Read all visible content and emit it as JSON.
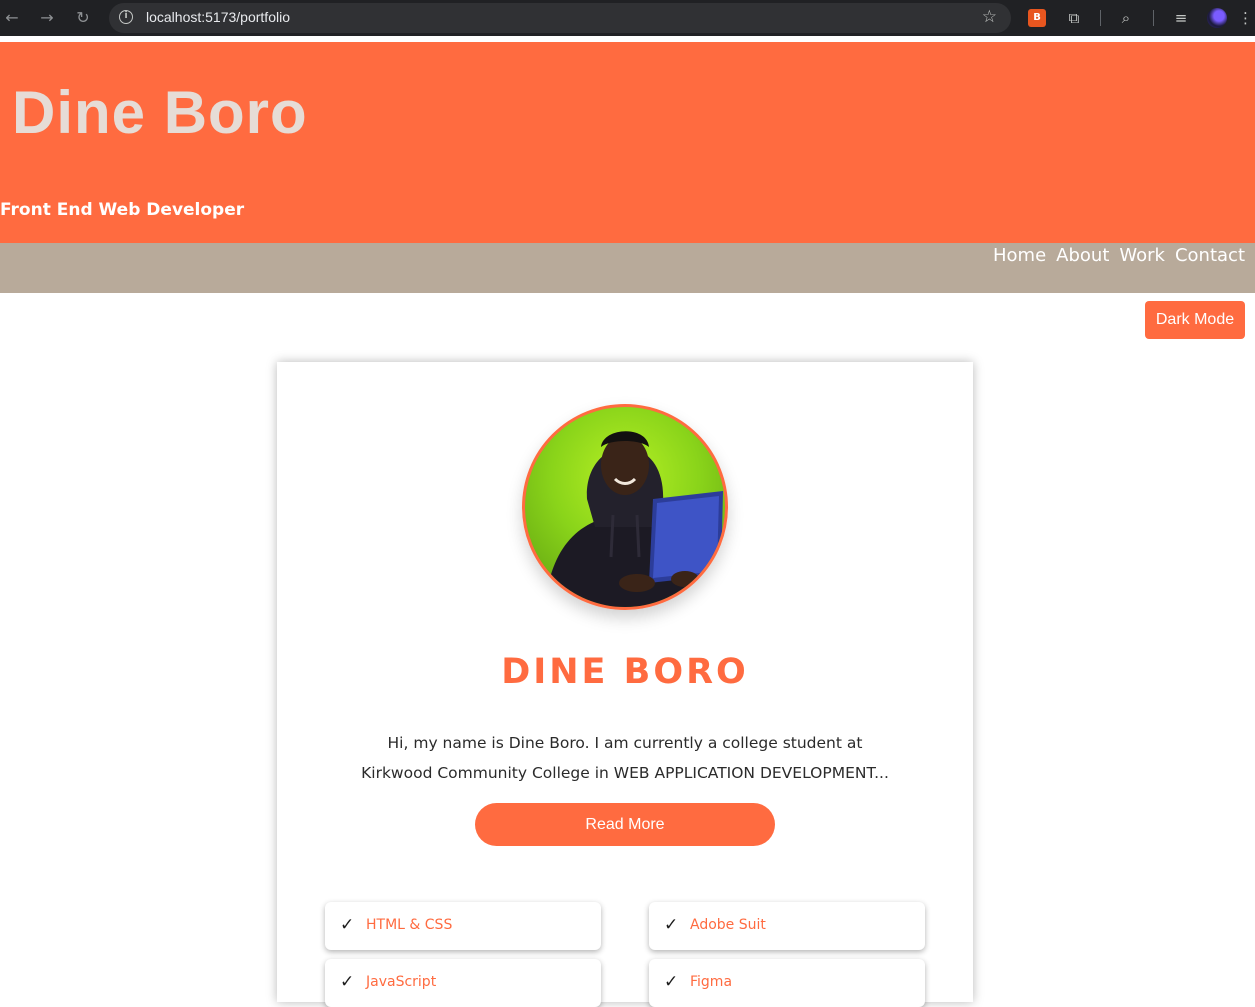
{
  "browser": {
    "url": "localhost:5173/portfolio",
    "back_icon": "arrow-left-icon",
    "forward_icon": "arrow-right-icon",
    "reload_icon": "reload-icon"
  },
  "header": {
    "title": "Dine Boro",
    "subtitle": "Front End Web Developer"
  },
  "nav": {
    "items": [
      "Home",
      "About",
      "Work",
      "Contact"
    ]
  },
  "theme": {
    "dark_mode_label": "Dark Mode",
    "accent": "#ff6b40",
    "nav_bg": "#b8aa9a"
  },
  "profile": {
    "name": "DINE BORO",
    "bio": "Hi, my name is Dine Boro. I am currently a college student at Kirkwood Community College in WEB APPLICATION DEVELOPMENT...",
    "read_more_label": "Read More"
  },
  "skills": {
    "check_symbol": "✓",
    "items": [
      "HTML & CSS",
      "Adobe Suit",
      "JavaScript",
      "Figma"
    ]
  }
}
